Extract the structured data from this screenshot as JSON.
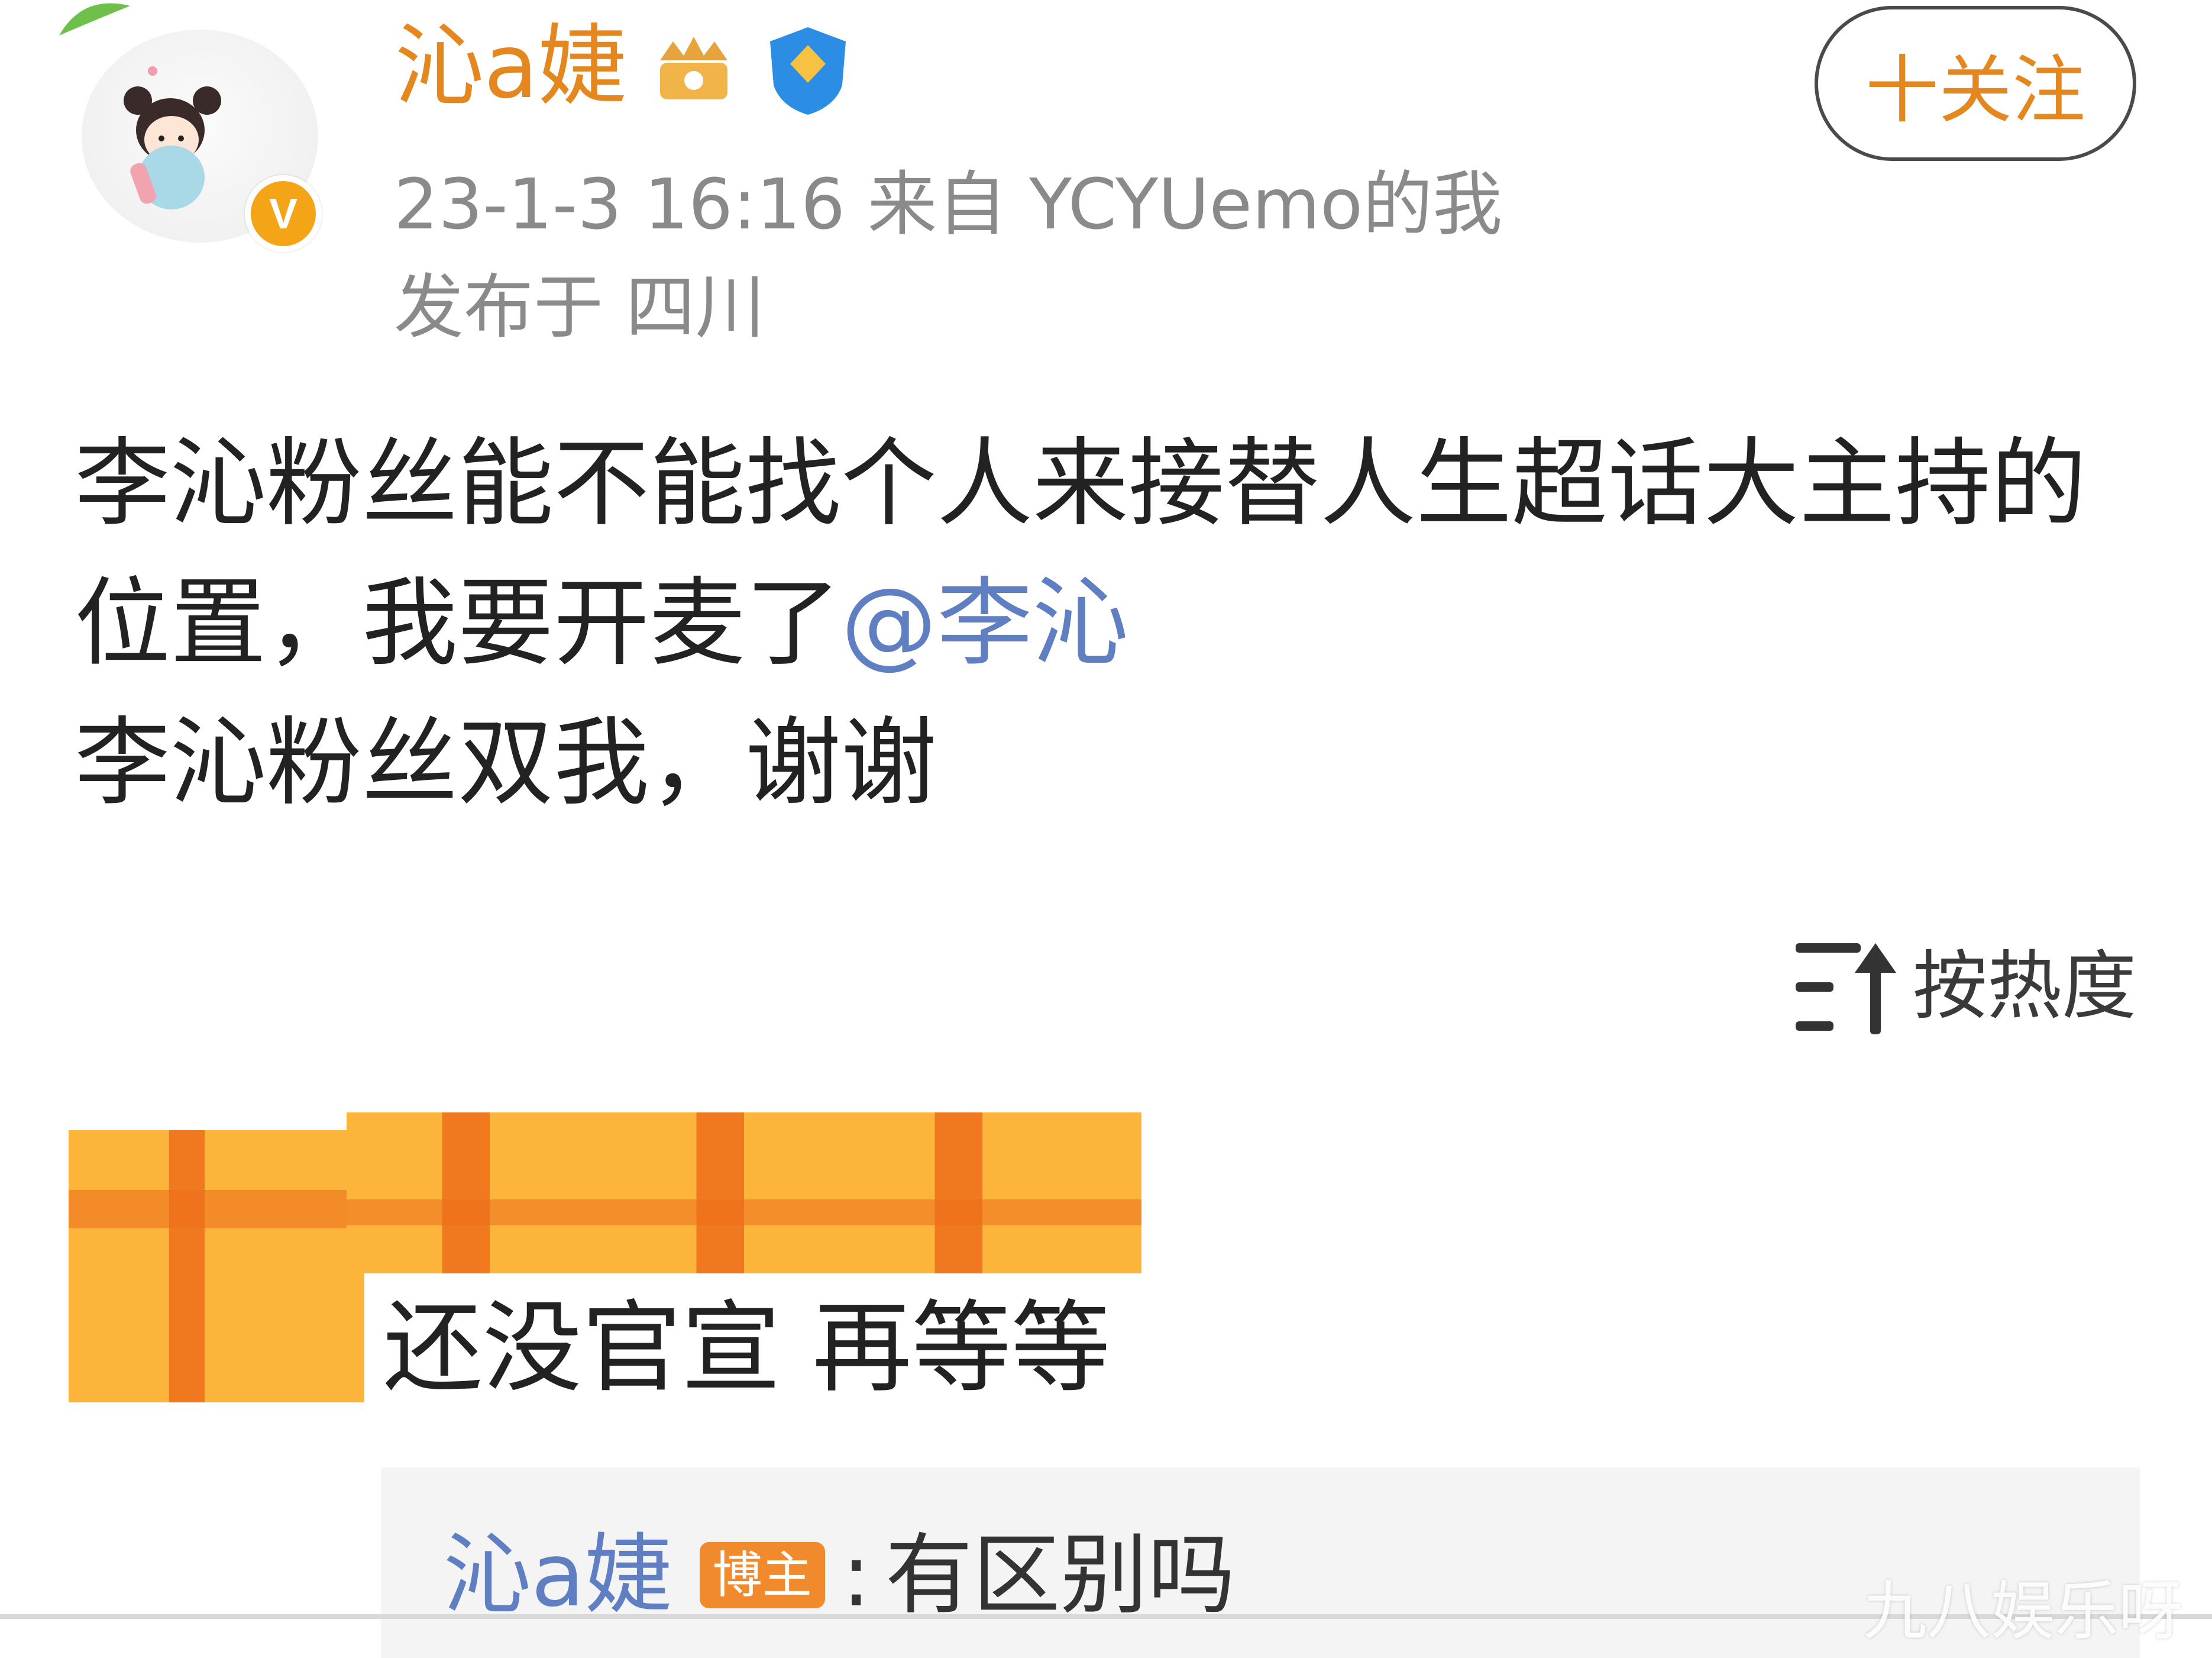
{
  "post": {
    "author": {
      "name": "沁a婕",
      "avatar_icon": "cartoon-girl-avatar-icon",
      "verified_badge_icon": "v-badge-icon",
      "level_icon": "crown-level-icon",
      "vip_icon": "blue-shield-badge-icon"
    },
    "time": "23-1-3 16:16",
    "source": "来自 YCYUemo的我",
    "location": "发布于 四川",
    "follow_label": "十关注",
    "body_prefix": "李沁粉丝能不能找个人来接替人生超话大主持的位置，我要开麦了",
    "mention": "@李沁",
    "body_suffix": "李沁粉丝双我，谢谢"
  },
  "sort": {
    "icon": "sort-by-popularity-icon",
    "label": "按热度"
  },
  "comment": {
    "text": "还没官宣 再等等",
    "reply": {
      "author": "沁a婕",
      "badge": "博主",
      "separator": ":",
      "text": "有区别吗"
    }
  },
  "watermark": "九八娱乐呀",
  "colors": {
    "username": "#e4871f",
    "link": "#5f7fc2",
    "meta": "#8a8a8a",
    "badge": "#f18a2c",
    "mosaic_base": "#fcb53a",
    "mosaic_dark": "#ee6e1a"
  }
}
